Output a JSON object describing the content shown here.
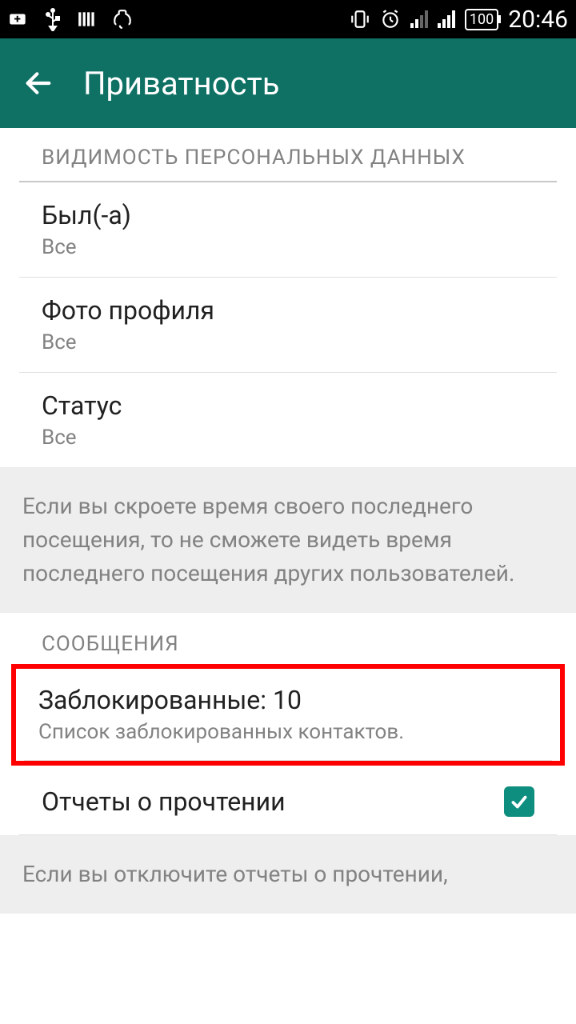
{
  "statusBar": {
    "time": "20:46",
    "battery": "100"
  },
  "appBar": {
    "title": "Приватность"
  },
  "sections": {
    "visibility": {
      "header": "ВИДИМОСТЬ ПЕРСОНАЛЬНЫХ ДАННЫХ",
      "lastSeen": {
        "title": "Был(-а)",
        "value": "Все"
      },
      "profilePhoto": {
        "title": "Фото профиля",
        "value": "Все"
      },
      "status": {
        "title": "Статус",
        "value": "Все"
      },
      "info": "Если вы скроете время своего последнего посещения, то не сможете видеть время последнего посещения других пользователей."
    },
    "messages": {
      "header": "СООБЩЕНИЯ",
      "blocked": {
        "title": "Заблокированные: 10",
        "subtitle": "Список заблокированных контактов."
      },
      "readReceipts": {
        "title": "Отчеты о прочтении",
        "checked": true
      },
      "info": "Если вы отключите отчеты о прочтении,"
    }
  }
}
